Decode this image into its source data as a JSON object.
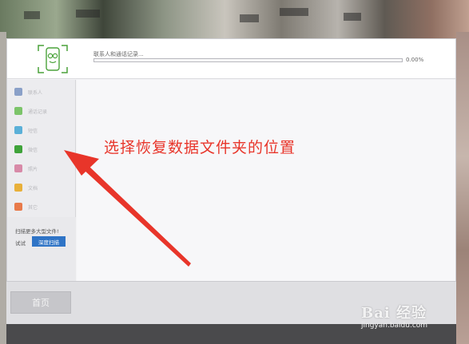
{
  "header": {
    "progress_label": "联系人和通话记录...",
    "progress_value": 0.0,
    "progress_percent": "0.00%"
  },
  "sidebar": {
    "items": [
      {
        "label": "联系人",
        "icon": "contacts-icon",
        "color": "#8aa0c8"
      },
      {
        "label": "通话记录",
        "icon": "phone-icon",
        "color": "#7cc46a"
      },
      {
        "label": "短信",
        "icon": "message-icon",
        "color": "#5ab0d8"
      },
      {
        "label": "微信",
        "icon": "wechat-icon",
        "color": "#3fa33a"
      },
      {
        "label": "照片",
        "icon": "photo-icon",
        "color": "#d88aa8"
      },
      {
        "label": "文档",
        "icon": "document-icon",
        "color": "#e8b03a"
      },
      {
        "label": "其它",
        "icon": "other-icon",
        "color": "#e87a4a"
      }
    ],
    "scan_text": "扫描更多大型文件!",
    "scan_try": "试试",
    "scan_button": "深度扫描"
  },
  "content": {
    "annotation": "选择恢复数据文件夹的位置",
    "annotation_color": "#e8352a"
  },
  "footer": {
    "home_button": "首页"
  },
  "watermark": {
    "logo": "Bai 经验",
    "url": "jingyan.baidu.com"
  }
}
